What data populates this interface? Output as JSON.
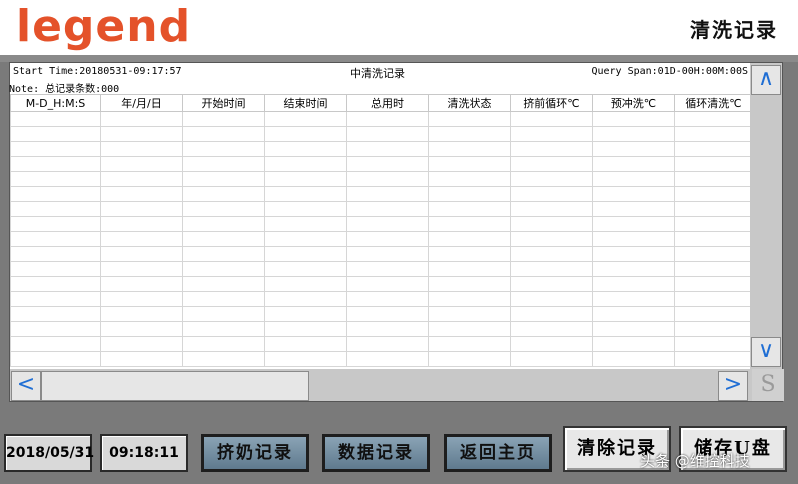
{
  "header": {
    "logo": "legend",
    "title": "清洗记录"
  },
  "record": {
    "start_time": "Start Time:20180531-09:17:57",
    "note": "Note: 总记录条数:000",
    "table_title": "中清洗记录",
    "query_span": "Query Span:01D-00H:00M:00S"
  },
  "table": {
    "columns": [
      "M-D_H:M:S",
      "年/月/日",
      "开始时间",
      "结束时间",
      "总用时",
      "清洗状态",
      "挤前循环℃",
      "预冲洗℃",
      "循环清洗℃"
    ],
    "row_count": 17
  },
  "scroll": {
    "up_icon": "chevron-up-icon",
    "down_icon": "chevron-down-icon",
    "left_icon": "chevron-left-icon",
    "right_icon": "chevron-right-icon",
    "up_glyph": "∧",
    "down_glyph": "∨",
    "left_glyph": "<",
    "right_glyph": ">",
    "corner_glyph": "S"
  },
  "footer": {
    "date": "2018/05/31",
    "time": "09:18:11",
    "milking_records": "挤奶记录",
    "data_records": "数据记录",
    "return_home": "返回主页",
    "clear_records": "清除记录",
    "save_to_usb": "储存U盘"
  },
  "watermark": "头条 @维控科技",
  "colors": {
    "logo": "#e4522a",
    "scroll_arrow": "#1f6ed4",
    "nav_button": "#6f8ba0"
  }
}
